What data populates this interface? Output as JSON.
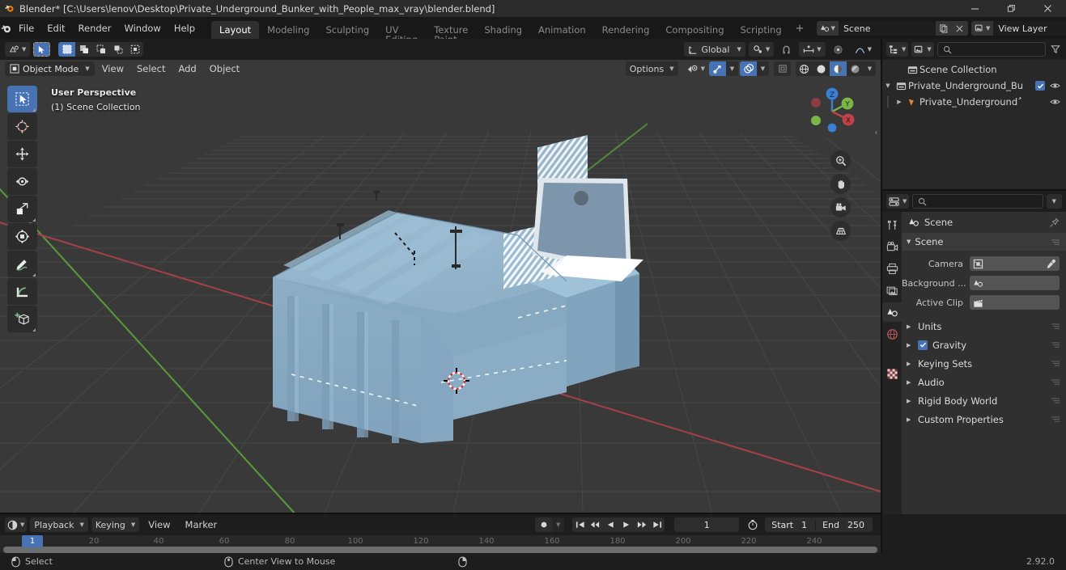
{
  "window": {
    "title": "Blender* [C:\\Users\\lenov\\Desktop\\Private_Underground_Bunker_with_People_max_vray\\blender.blend]",
    "minimize": "–",
    "maximize": "❐",
    "close": "✕"
  },
  "topbar": {
    "menus": [
      "File",
      "Edit",
      "Render",
      "Window",
      "Help"
    ],
    "workspaces": [
      {
        "label": "Layout",
        "active": true
      },
      {
        "label": "Modeling",
        "active": false
      },
      {
        "label": "Sculpting",
        "active": false
      },
      {
        "label": "UV Editing",
        "active": false
      },
      {
        "label": "Texture Paint",
        "active": false
      },
      {
        "label": "Shading",
        "active": false
      },
      {
        "label": "Animation",
        "active": false
      },
      {
        "label": "Rendering",
        "active": false
      },
      {
        "label": "Compositing",
        "active": false
      },
      {
        "label": "Scripting",
        "active": false
      }
    ],
    "add_workspace": "+",
    "scene_name": "Scene",
    "view_layer_name": "View Layer"
  },
  "viewport": {
    "header": {
      "editor_type": "editor-type-3dview",
      "mode": "Object Mode",
      "menus": [
        "View",
        "Select",
        "Add",
        "Object"
      ],
      "transform_orientation": "Global",
      "options": "Options"
    },
    "overlay": {
      "perspective": "User Perspective",
      "collection": "(1) Scene Collection"
    },
    "gizmo_axes": [
      "Z",
      "Y",
      "X"
    ],
    "tools": [
      "tweak-select-tool",
      "cursor-tool",
      "move-tool",
      "rotate-tool",
      "scale-tool",
      "transform-tool",
      "annotate-tool",
      "measure-tool",
      "add-cube-tool"
    ],
    "nav_buttons": [
      "zoom-icon",
      "pan-hand-icon",
      "camera-view-icon",
      "perspective-toggle-icon"
    ]
  },
  "outliner": {
    "search_placeholder": "",
    "rows": [
      {
        "name": "Scene Collection",
        "icon": "collection-icon",
        "depth": 0,
        "expandable": false,
        "checkbox": false,
        "eye": false
      },
      {
        "name": "Private_Underground_Bu",
        "icon": "collection-icon",
        "depth": 1,
        "expandable": true,
        "expanded": true,
        "checkbox": true,
        "eye": true
      },
      {
        "name": "Private_Undergroundُ",
        "icon": "mesh-object-icon",
        "depth": 2,
        "expandable": true,
        "expanded": false,
        "checkbox": false,
        "eye": true
      }
    ]
  },
  "properties": {
    "tabs": [
      {
        "name": "tool-tab",
        "icon": "tool-icon",
        "active": false
      },
      {
        "name": "render-tab",
        "icon": "render-camera-icon",
        "active": false
      },
      {
        "name": "output-tab",
        "icon": "printer-icon",
        "active": false
      },
      {
        "name": "view-layer-tab",
        "icon": "images-icon",
        "active": false
      },
      {
        "name": "scene-tab",
        "icon": "scene-cone-icon",
        "active": true
      },
      {
        "name": "world-tab",
        "icon": "world-globe-icon",
        "active": false
      },
      {
        "name": "texture-tab",
        "icon": "checker-texture-icon",
        "active": false
      }
    ],
    "breadcrumb": "Scene",
    "panel_title": "Scene",
    "fields": [
      {
        "label": "Camera",
        "value": "",
        "icon": "camera-data-icon",
        "eyedropper": true
      },
      {
        "label": "Background ...",
        "value": "",
        "icon": "scene-cone-icon",
        "eyedropper": false
      },
      {
        "label": "Active Clip",
        "value": "",
        "icon": "movie-clip-icon",
        "eyedropper": false
      }
    ],
    "sections": [
      {
        "label": "Units",
        "checkbox": false
      },
      {
        "label": "Gravity",
        "checkbox": true,
        "checked": true
      },
      {
        "label": "Keying Sets",
        "checkbox": false
      },
      {
        "label": "Audio",
        "checkbox": false
      },
      {
        "label": "Rigid Body World",
        "checkbox": false
      },
      {
        "label": "Custom Properties",
        "checkbox": false
      }
    ]
  },
  "timeline": {
    "menus": [
      "Playback",
      "Keying",
      "View",
      "Marker"
    ],
    "current_frame": "1",
    "start_label": "Start",
    "start_value": "1",
    "end_label": "End",
    "end_value": "250",
    "ruler_ticks": [
      "20",
      "40",
      "60",
      "80",
      "100",
      "120",
      "140",
      "160",
      "180",
      "200",
      "220",
      "240"
    ],
    "playhead_label": "1"
  },
  "statusbar": {
    "items": [
      {
        "icon": "mouse-left-icon",
        "label": "Select"
      },
      {
        "icon": "mouse-middle-icon",
        "label": "Center View to Mouse"
      },
      {
        "icon": "mouse-right-icon",
        "label": ""
      }
    ],
    "version": "2.92.0"
  },
  "colors": {
    "accent": "#4772b3",
    "model": "#92b2c9",
    "header_bg": "#1d1d1d",
    "viewport_bg": "#393939",
    "axis_x": "#c0424a",
    "axis_y": "#7ab648",
    "axis_z": "#3a7fd5"
  }
}
